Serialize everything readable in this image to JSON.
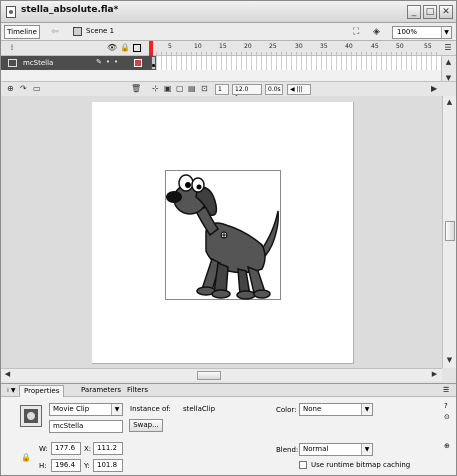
{
  "window": {
    "title": "stella_absolute.fla*"
  },
  "scenebar": {
    "timeline_label": "Timeline",
    "scene_label": "Scene 1",
    "zoom_value": "100%"
  },
  "timeline": {
    "ruler_numbers": [
      "5",
      "10",
      "15",
      "20",
      "25",
      "30",
      "35",
      "40",
      "45",
      "50",
      "55"
    ],
    "layer_name": "mcStella",
    "current_frame": "1",
    "frame_rate": "12.0 fps",
    "elapsed_time": "0.0s"
  },
  "properties": {
    "tabs": [
      "Properties",
      "Parameters",
      "Filters"
    ],
    "symbol_type": "Movie Clip",
    "instance_name": "mcStella",
    "instance_of_label": "Instance of:",
    "instance_of_value": "stellaClip",
    "swap_label": "Swap...",
    "color_label": "Color:",
    "color_value": "None",
    "w_label": "W:",
    "w_value": "177.6",
    "h_label": "H:",
    "h_value": "196.4",
    "x_label": "X:",
    "x_value": "111.2",
    "y_label": "Y:",
    "y_value": "101.8",
    "blend_label": "Blend:",
    "blend_value": "Normal",
    "cache_label": "Use runtime bitmap caching"
  },
  "colors": {
    "layer_row": "#4d4d4d",
    "playhead": "#ee0000",
    "stage": "#ffffff",
    "dog_body": "#555555"
  }
}
